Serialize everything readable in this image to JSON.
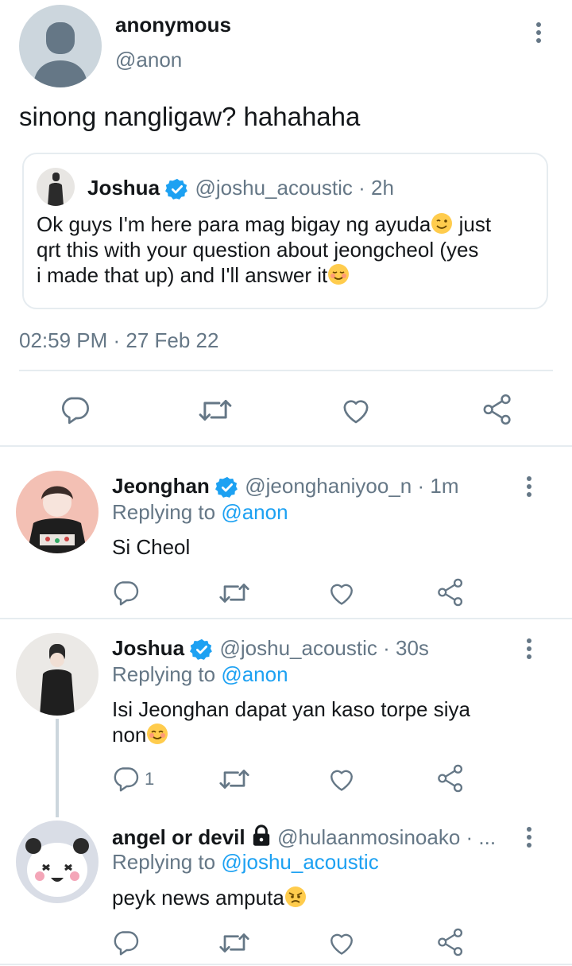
{
  "main_tweet": {
    "display_name": "anonymous",
    "handle": "@anon",
    "text": "sinong nangligaw? hahahaha",
    "timestamp": "02:59 PM · 27 Feb 22",
    "quoted": {
      "display_name": "Joshua",
      "handle": "@joshu_acoustic",
      "time": "· 2h",
      "text_line1": "Ok guys I'm here para mag bigay ng ayuda",
      "text_line1_end": " just",
      "text_line2": "qrt this with your question about jeongcheol (yes",
      "text_line3": "i made that up) and I'll answer it"
    }
  },
  "replies": [
    {
      "display_name": "Jeonghan",
      "handle": "@jeonghaniyoo_n",
      "time": "· 1m",
      "replying_prefix": "Replying to",
      "replying_to": "@anon",
      "text": "Si Cheol",
      "reply_count": ""
    },
    {
      "display_name": "Joshua",
      "handle": "@joshu_acoustic",
      "time": "· 30s",
      "replying_prefix": "Replying to",
      "replying_to": "@anon",
      "text_line1": "Isi Jeonghan dapat yan kaso torpe siya",
      "text_line2": "non",
      "reply_count": "1"
    },
    {
      "display_name": "angel or devil",
      "handle": "@hulaanmosinoako · ...",
      "replying_prefix": "Replying to",
      "replying_to": "@joshu_acoustic",
      "text": "peyk news amputa",
      "reply_count": ""
    }
  ],
  "colors": {
    "verified": "#1da1f2",
    "link": "#1da1f2",
    "muted": "#657786",
    "divider": "#e6ecf0"
  },
  "icons": [
    "reply-icon",
    "retweet-icon",
    "like-icon",
    "share-icon",
    "more-icon",
    "verified-icon",
    "lock-icon"
  ]
}
